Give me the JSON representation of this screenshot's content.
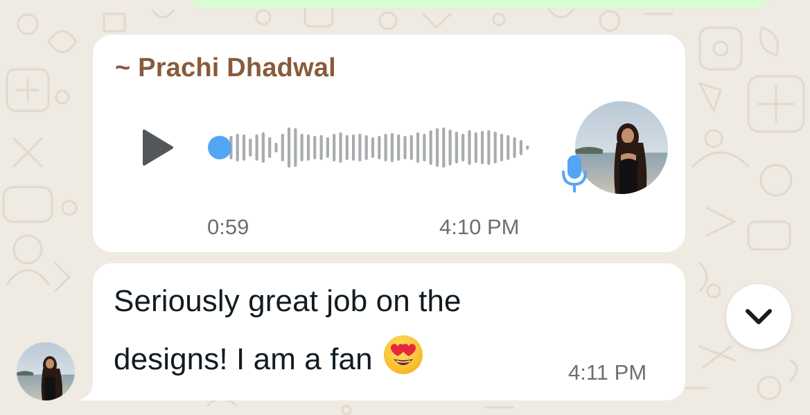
{
  "voice_message": {
    "sender": "~ Prachi Dhadwal",
    "duration": "0:59",
    "time": "4:10 PM",
    "playback_progress": 0
  },
  "text_message": {
    "line1": "Seriously great job on the",
    "line2": "designs! I am a fan",
    "emoji": "smiling-face-with-heart-eyes",
    "time": "4:11 PM"
  },
  "icons": {
    "play": "play-icon",
    "mic": "microphone-icon",
    "scroll_down": "chevron-down-icon"
  },
  "colors": {
    "wallpaper": "#efeae2",
    "bubble": "#ffffff",
    "outgoing_bubble": "#d9fdd3",
    "sender_name": "#8a5a3c",
    "accent_blue": "#53a6f5",
    "waveform": "#a8acae",
    "timestamp": "#6b6f72"
  }
}
